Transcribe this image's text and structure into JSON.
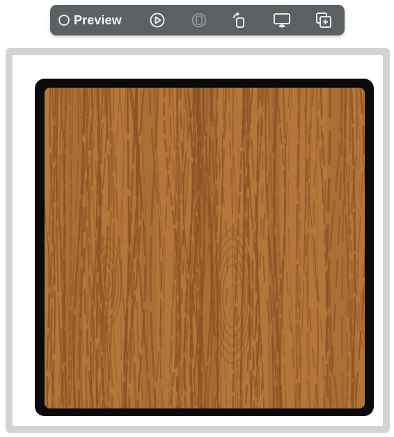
{
  "toolbar": {
    "preview_label": "Preview",
    "preview_icon": "radio-empty-icon",
    "buttons": [
      {
        "name": "live-preview-button",
        "icon": "play-circle-icon"
      },
      {
        "name": "variants-button",
        "icon": "device-variants-icon"
      },
      {
        "name": "rotate-device-button",
        "icon": "rotate-device-icon"
      },
      {
        "name": "device-settings-button",
        "icon": "display-settings-icon"
      },
      {
        "name": "duplicate-preview-button",
        "icon": "duplicate-plus-icon"
      }
    ]
  },
  "canvas": {
    "content": "wood-texture-image"
  },
  "colors": {
    "toolbar_bg": "#5b6063",
    "toolbar_fg": "#f3f4f5",
    "frame": "#d4d4d4",
    "device_bezel": "#0b0b0b",
    "wood_base": "#b5763a",
    "wood_grain": "#8a5226"
  }
}
